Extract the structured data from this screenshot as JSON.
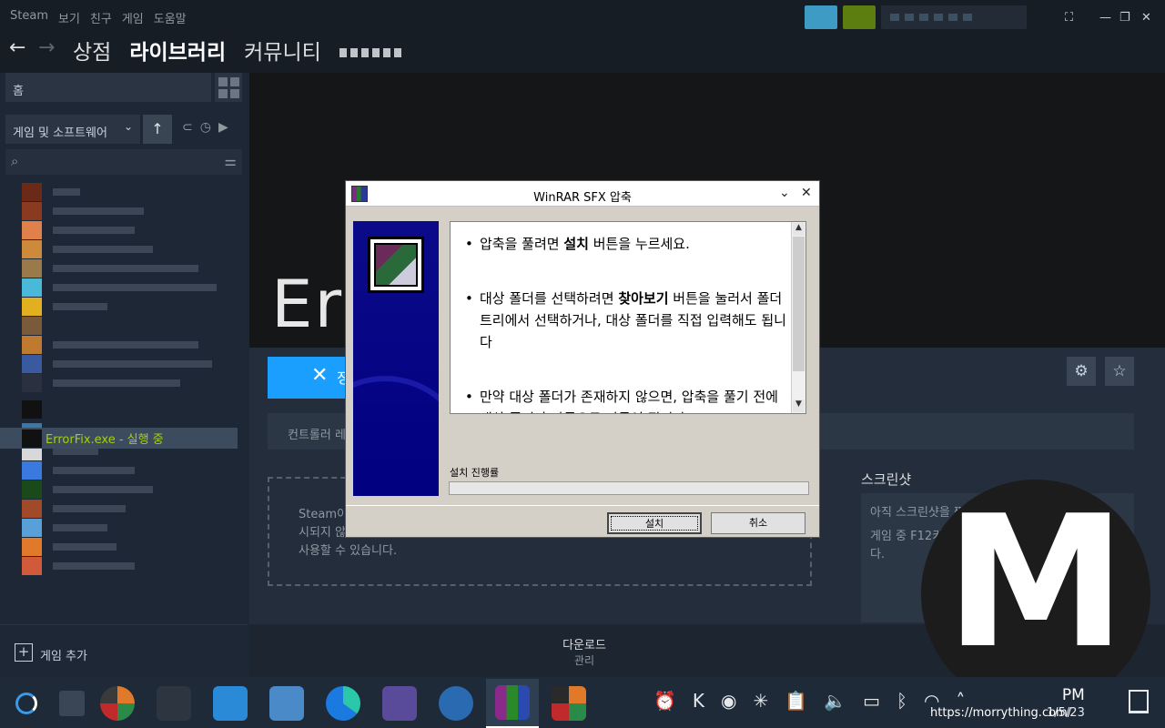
{
  "steam": {
    "menu": [
      "Steam",
      "보기",
      "친구",
      "게임",
      "도움말"
    ],
    "nav_tabs": [
      "상점",
      "라이브러리",
      "커뮤니티"
    ],
    "active_tab": "라이브러리"
  },
  "library": {
    "home_label": "홈",
    "filter_label": "게임 및 소프트웨어",
    "running_game": {
      "name": "ErrorFix.exe",
      "status": " - 실행 중"
    },
    "add_game_label": "게임 추가"
  },
  "game_page": {
    "hero_title_visible": "Err",
    "stop_button_label": "정",
    "controller_text": "컨트롤러 레",
    "activity_lines": [
      "Steam이",
      "시되지 않",
      "사용할 수 있습니다."
    ],
    "screenshots_title": "스크린샷",
    "screenshots_lines": [
      "아직 스크린샷을 찍",
      "게임 중 F12키",
      "다."
    ],
    "downloads_label": "다운로드",
    "downloads_sub": "관리"
  },
  "dialog": {
    "title": "WinRAR SFX 압축",
    "bullets": [
      {
        "pre": "압축을 풀려면 ",
        "bold": "설치",
        "post": " 버튼을 누르세요."
      },
      {
        "pre": "대상 폴더를 선택하려면 ",
        "bold": "찾아보기",
        "post": " 버튼을 눌러서 폴더 트리에서 선택하거나, 대상 폴더를 직접 입력해도 됩니다"
      },
      {
        "pre": "만약 대상 폴더가 존재하지 않으면, 압축을 풀기 전에 대상 폴더가 자동으로 만들어 집니다.",
        "bold": "",
        "post": ""
      }
    ],
    "progress_label": "설치 진행률",
    "progress_value": 0,
    "install_button": "설치",
    "cancel_button": "취소"
  },
  "taskbar": {
    "clock_time": "PM",
    "clock_date": "1/5/23"
  },
  "watermark": {
    "url": "https://morrything.com/"
  }
}
